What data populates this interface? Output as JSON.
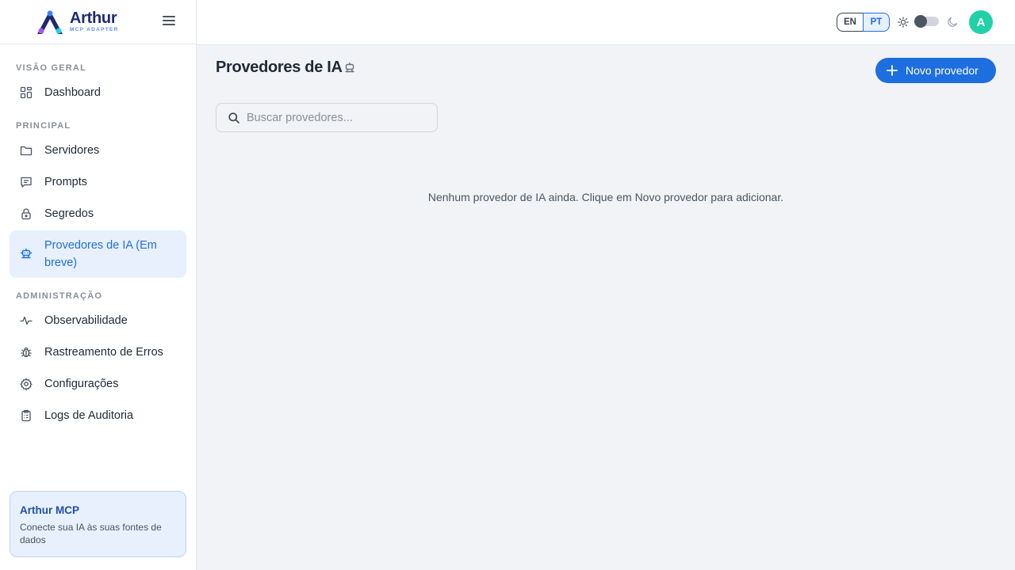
{
  "brand": {
    "name": "Arthur",
    "subtitle": "MCP ADAPTER"
  },
  "sidebar": {
    "sections": [
      {
        "label": "VISÃO GERAL"
      },
      {
        "label": "PRINCIPAL"
      },
      {
        "label": "ADMINISTRAÇÃO"
      }
    ],
    "items": [
      {
        "label": "Dashboard",
        "icon": "dashboard-icon"
      },
      {
        "label": "Servidores",
        "icon": "folder-icon"
      },
      {
        "label": "Prompts",
        "icon": "message-icon"
      },
      {
        "label": "Segredos",
        "icon": "lock-icon"
      },
      {
        "label": "Provedores de IA (Em breve)",
        "icon": "robot-icon",
        "active": true
      },
      {
        "label": "Observabilidade",
        "icon": "activity-icon"
      },
      {
        "label": "Rastreamento de Erros",
        "icon": "bug-icon"
      },
      {
        "label": "Configurações",
        "icon": "gear-icon"
      },
      {
        "label": "Logs de Auditoria",
        "icon": "clipboard-icon"
      }
    ],
    "promo": {
      "title": "Arthur MCP",
      "description": "Conecte sua IA às suas fontes de dados"
    }
  },
  "header": {
    "languages": [
      "EN",
      "PT"
    ],
    "selected_language": "PT",
    "theme": "light",
    "avatar_initial": "A"
  },
  "main": {
    "title": "Provedores de IA",
    "new_button_label": "Novo provedor",
    "search": {
      "placeholder": "Buscar provedores...",
      "value": ""
    },
    "empty_message": "Nenhum provedor de IA ainda. Clique em Novo provedor para adicionar."
  },
  "colors": {
    "accent": "#1d6fe0",
    "active_bg": "#e8f0fd",
    "avatar": "#20d1a8"
  }
}
